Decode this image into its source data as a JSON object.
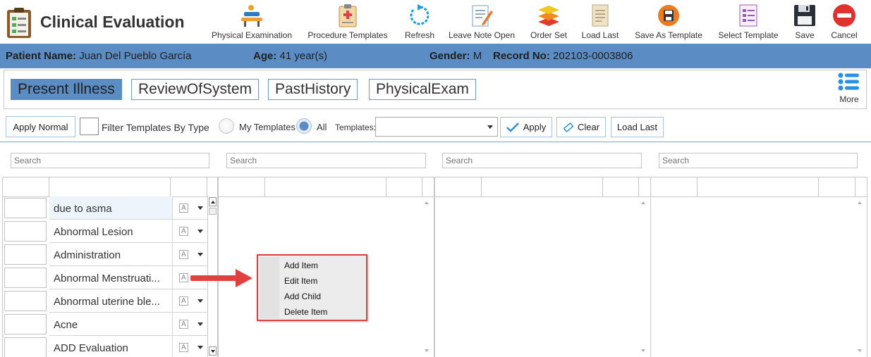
{
  "app": {
    "title": "Clinical Evaluation"
  },
  "toolbar": [
    {
      "id": "physical-examination",
      "label": "Physical Examination",
      "icon": "exam-table-icon"
    },
    {
      "id": "procedure-templates",
      "label": "Procedure Templates",
      "icon": "medical-clipboard-icon"
    },
    {
      "id": "refresh",
      "label": "Refresh",
      "icon": "refresh-icon"
    },
    {
      "id": "leave-note-open",
      "label": "Leave Note Open",
      "icon": "note-pencil-icon"
    },
    {
      "id": "order-set",
      "label": "Order Set",
      "icon": "layers-icon"
    },
    {
      "id": "load-last",
      "label": "Load Last",
      "icon": "document-icon"
    },
    {
      "id": "save-as-template",
      "label": "Save As Template",
      "icon": "save-circle-icon"
    },
    {
      "id": "select-template",
      "label": "Select Template",
      "icon": "checklist-icon"
    },
    {
      "id": "save",
      "label": "Save",
      "icon": "floppy-disk-icon"
    },
    {
      "id": "cancel",
      "label": "Cancel",
      "icon": "cancel-icon"
    }
  ],
  "patient": {
    "name_label": "Patient Name:",
    "name": "Juan Del Pueblo García",
    "age_label": "Age:",
    "age": "41 year(s)",
    "gender_label": "Gender:",
    "gender": "M",
    "record_label": "Record No:",
    "record": "202103-0003806"
  },
  "tabs": [
    {
      "label": "Present Illness",
      "active": true
    },
    {
      "label": "ReviewOfSystem",
      "active": false
    },
    {
      "label": "PastHistory",
      "active": false
    },
    {
      "label": "PhysicalExam",
      "active": false
    }
  ],
  "more_label": "More",
  "filter": {
    "apply_normal": "Apply Normal",
    "filter_by_type": "Filter Templates By Type",
    "my_templates": "My Templates",
    "all": "All",
    "templates_label": "Templates:",
    "templates_value": "",
    "apply": "Apply",
    "clear": "Clear",
    "load_last": "Load Last"
  },
  "search_placeholder": "Search",
  "items": [
    "due to asma",
    "Abnormal Lesion",
    "Administration",
    "Abnormal Menstruati...",
    "Abnormal uterine ble...",
    "Acne",
    "ADD Evaluation"
  ],
  "context_menu": [
    "Add Item",
    "Edit Item",
    "Add Child",
    "Delete Item"
  ],
  "colors": {
    "accent": "#5b8cc4",
    "highlight": "#e04040"
  }
}
